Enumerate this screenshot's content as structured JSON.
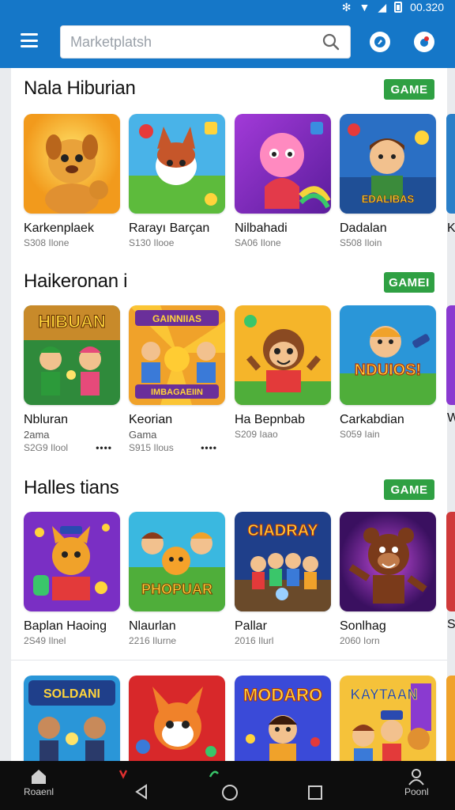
{
  "status": {
    "time": "00.320"
  },
  "search": {
    "placeholder": "Marketplatsh"
  },
  "sections": [
    {
      "title": "Nala Hiburian",
      "badge": "GAME",
      "items": [
        {
          "name": "Karkenplaek",
          "meta": "S308 Ilone"
        },
        {
          "name": "Rarayı Barçan",
          "meta": "S130 Ilooe"
        },
        {
          "name": "Nilbahadi",
          "meta": "SA06 Ilone"
        },
        {
          "name": "Dadalan",
          "meta": "S508 Iloin"
        }
      ],
      "peek": "Ka"
    },
    {
      "title": "Haikeronan i",
      "badge": "GAMEI",
      "items": [
        {
          "name": "Nbluran",
          "sub": "2ama",
          "meta": "S2G9 Ilool",
          "dots": "••••"
        },
        {
          "name": "Keorian",
          "sub": "Gama",
          "meta": "S915 Ilous",
          "dots": "••••"
        },
        {
          "name": "Ha Bepnbab",
          "meta": "S209 Iaao"
        },
        {
          "name": "Carkabdian",
          "meta": "S059 Iain"
        }
      ],
      "peek": "W"
    },
    {
      "title": "Halles tians",
      "badge": "GAME",
      "items": [
        {
          "name": "Baplan Haoing",
          "meta": "2S49 Ilnel"
        },
        {
          "name": "Nlaurlan",
          "meta": "2216 Ilurne"
        },
        {
          "name": "Pallar",
          "meta": "2016 Ilurl"
        },
        {
          "name": "Sonlhag",
          "meta": "2060 Iorn"
        }
      ],
      "peek": "S"
    }
  ],
  "bottom_row_titles": [
    "SOLDANI",
    "MODARO",
    "KAYTAAN"
  ],
  "thumb_titles": {
    "s1_3": "EDALIBAS",
    "s2_0": "HIBUAN",
    "s2_1_top": "GAINNIIAS",
    "s2_1_bot": "IMBAGAEIIN",
    "s2_3": "NDUIOS!",
    "s3_1": "PHOPUAR",
    "s3_2": "CIADRAY"
  },
  "nav": {
    "left_label": "Roaenl",
    "right_label": "Poonl"
  },
  "colors": {
    "topbar": "#1577c8",
    "badge": "#2fa043",
    "navbar": "#0d0d0d"
  }
}
